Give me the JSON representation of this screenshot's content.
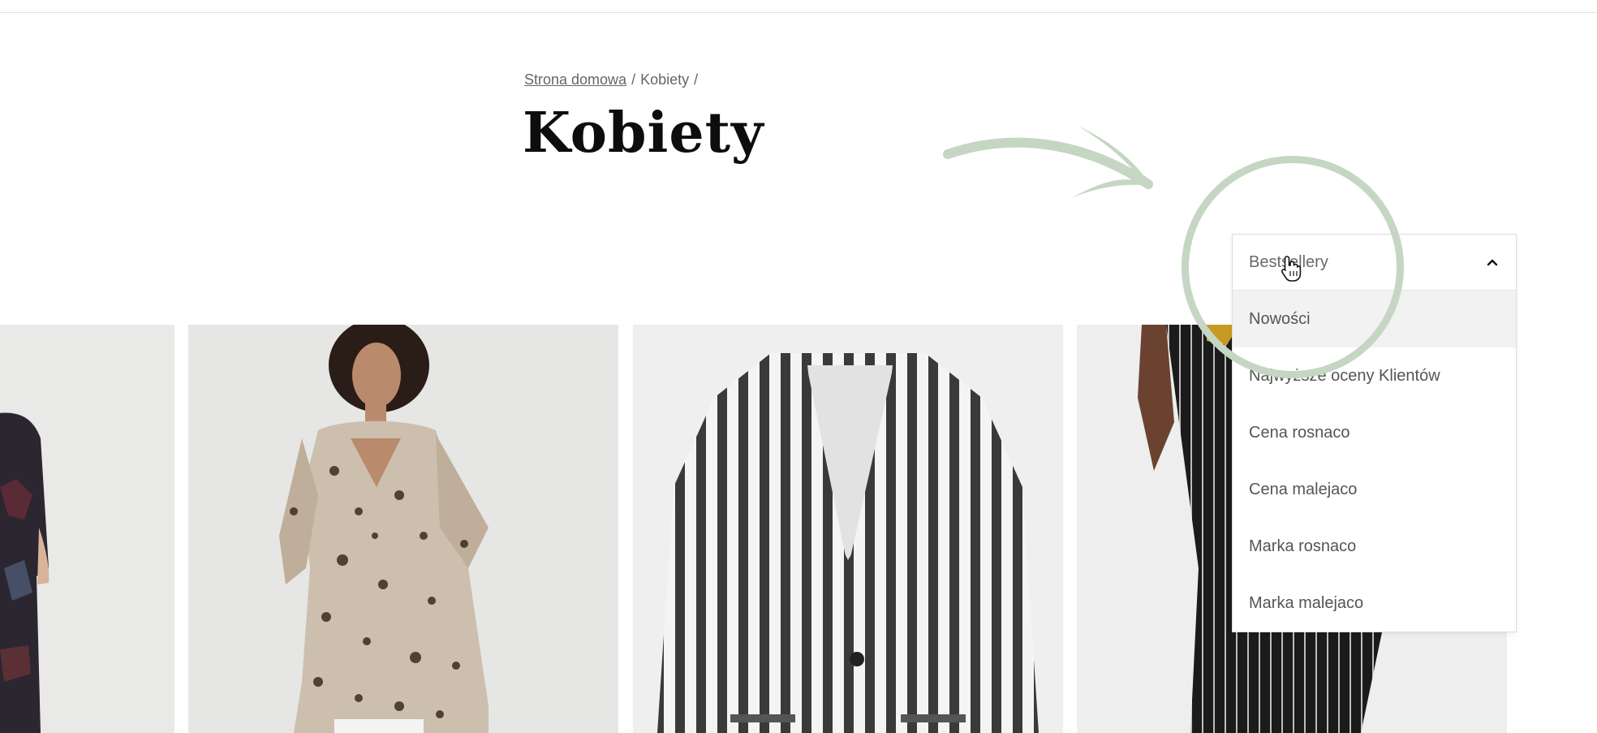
{
  "breadcrumb": {
    "home": "Strona domowa",
    "current": "Kobiety",
    "separator": "/"
  },
  "page_title": "Kobiety",
  "sort": {
    "selected": "Bestsellery",
    "expanded": true,
    "options": [
      "Nowości",
      "Najwyższe oceny Klientów",
      "Cena rosnaco",
      "Cena malejaco",
      "Marka rosnaco",
      "Marka malejaco"
    ],
    "highlighted_option": "Nowości"
  },
  "products": [
    {
      "name": "printed-dress-image"
    },
    {
      "name": "leopard-print-dress-image"
    },
    {
      "name": "striped-blazer-image"
    },
    {
      "name": "pinstripe-trousers-image"
    }
  ],
  "annotation": {
    "color": "#c5d6c3"
  }
}
